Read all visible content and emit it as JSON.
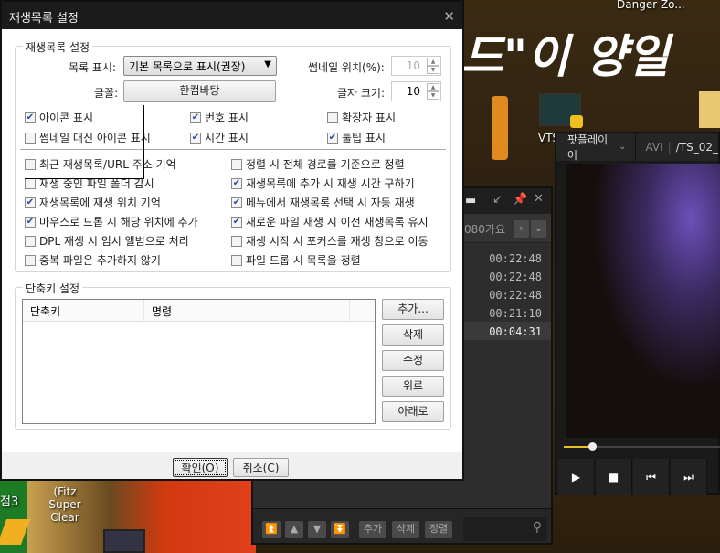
{
  "desktop": {
    "big_text": "드\"이 양일",
    "labels": [
      "Danger Zo...",
      "VTS",
      "(Fitz Super Clear",
      "점3"
    ]
  },
  "dialog": {
    "title": "재생목록 설정",
    "group1": {
      "title": "재생목록 설정",
      "list_display_label": "목록 표시:",
      "list_display_value": "기본 목록으로 표시(권장)",
      "font_label": "글꼴:",
      "font_value": "한컴바탕",
      "thumb_pos_label": "썸네일 위치(%):",
      "thumb_pos_value": "10",
      "font_size_label": "글자 크기:",
      "font_size_value": "10",
      "checks_top": [
        {
          "label": "아이콘 표시",
          "checked": true
        },
        {
          "label": "번호 표시",
          "checked": true
        },
        {
          "label": "확장자 표시",
          "checked": false
        },
        {
          "label": "썸네일 대신 아이콘 표시",
          "checked": false
        },
        {
          "label": "시간 표시",
          "checked": true
        },
        {
          "label": "툴팁 표시",
          "checked": true
        }
      ],
      "checks_left": [
        {
          "label": "최근 재생목록/URL 주소 기억",
          "checked": false
        },
        {
          "label": "재생 중인 파일 폴더 감시",
          "checked": false
        },
        {
          "label": "재생목록에 재생 위치 기억",
          "checked": true
        },
        {
          "label": "마우스로 드롭 시 해당 위치에 추가",
          "checked": true
        },
        {
          "label": "DPL 재생 시 임시 앨범으로 처리",
          "checked": false
        },
        {
          "label": "중복 파일은 추가하지 않기",
          "checked": false
        }
      ],
      "checks_right": [
        {
          "label": "정렬 시 전체 경로를 기준으로 정렬",
          "checked": false
        },
        {
          "label": "재생목록에 추가 시 재생 시간 구하기",
          "checked": true
        },
        {
          "label": "메뉴에서 재생목록 선택 시 자동 재생",
          "checked": true
        },
        {
          "label": "새로운 파일 재생 시 이전 재생목록 유지",
          "checked": true
        },
        {
          "label": "재생 시작 시 포커스를 재생 창으로 이동",
          "checked": false
        },
        {
          "label": "파일 드롭 시 목록을 정렬",
          "checked": false
        }
      ]
    },
    "group2": {
      "title": "단축키 설정",
      "columns": [
        "단축키",
        "명령"
      ],
      "buttons": [
        "추가...",
        "삭제",
        "수정",
        "위로",
        "아래로"
      ]
    },
    "ok": "확인(O)",
    "cancel": "취소(C)"
  },
  "playlist": {
    "folder": "080가요",
    "times": [
      "00:22:48",
      "00:22:48",
      "00:22:48",
      "00:21:10",
      "00:04:31"
    ],
    "bottom_buttons": [
      "추가",
      "삭제",
      "정렬"
    ]
  },
  "player": {
    "name": "팟플레이어",
    "format": "AVI",
    "file": "/TS_02_",
    "progress_percent": 18
  }
}
